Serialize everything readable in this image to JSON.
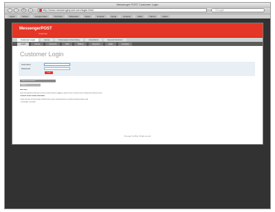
{
  "browser": {
    "window_title": "Messenger POST Customer Login",
    "url": "http://www.messengerpost.com/login.html",
    "search_placeholder": "Google",
    "nav": {
      "back": "‹",
      "forward": "›",
      "reload": "↻",
      "home": "⌂"
    },
    "bookmarks": [
      "Apple",
      "Yahoo!",
      "Google Maps",
      "YouTube",
      "Wikipedia",
      "News",
      "Popular",
      "Apple",
      "Amazon",
      "eBay",
      "Yahoo!",
      "News"
    ]
  },
  "site": {
    "logo": "MessengerPOST",
    "logo_sub": "Customer",
    "top_tabs": [
      "Customer Login",
      "Home",
      "Newspaper Advertising",
      "Classifieds",
      "Special Sections"
    ],
    "menu": [
      "Login",
      "Home",
      "Account",
      "Ads",
      "Billing",
      "Reports",
      "Help",
      "Contact"
    ],
    "page_title": "Customer Login",
    "form": {
      "username_label": "Username",
      "password_label": "Password",
      "login_button": "Login"
    },
    "links": [
      "Forgot your password?",
      "Register"
    ],
    "help": [
      "Need help?",
      "If you have questions about your account or need assistance logging in, please contact customer service during normal business hours.",
      "Customer service contact information",
      "Please have your account number available when calling. Representatives are available Monday through Friday.",
      "© Messenger Post Media"
    ],
    "footer": "Messenger Post Media · All rights reserved"
  },
  "colors": {
    "brand_red": "#e43526",
    "page_background": "#323233",
    "login_box": "#e8f0f6"
  }
}
